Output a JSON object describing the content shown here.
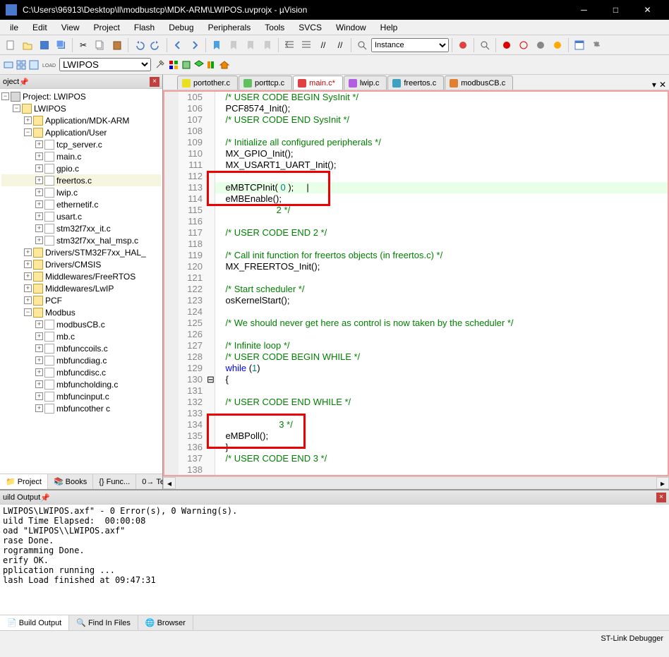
{
  "title": "C:\\Users\\96913\\Desktop\\ll\\modbustcp\\MDK-ARM\\LWIPOS.uvprojx - µVision",
  "menus": [
    "ile",
    "Edit",
    "View",
    "Project",
    "Flash",
    "Debug",
    "Peripherals",
    "Tools",
    "SVCS",
    "Window",
    "Help"
  ],
  "instance_label": "Instance",
  "target_name": "LWIPOS",
  "project": {
    "title": "oject",
    "root": "Project: LWIPOS",
    "target": "LWIPOS",
    "groups": [
      {
        "name": "Application/MDK-ARM",
        "files": []
      },
      {
        "name": "Application/User",
        "open": true,
        "files": [
          "tcp_server.c",
          "main.c",
          "gpio.c",
          "freertos.c",
          "lwip.c",
          "ethernetif.c",
          "usart.c",
          "stm32f7xx_it.c",
          "stm32f7xx_hal_msp.c"
        ]
      },
      {
        "name": "Drivers/STM32F7xx_HAL_",
        "files": []
      },
      {
        "name": "Drivers/CMSIS",
        "files": []
      },
      {
        "name": "Middlewares/FreeRTOS",
        "files": []
      },
      {
        "name": "Middlewares/LwIP",
        "files": []
      },
      {
        "name": "PCF",
        "files": []
      },
      {
        "name": "Modbus",
        "open": true,
        "files": [
          "modbusCB.c",
          "mb.c",
          "mbfunccoils.c",
          "mbfuncdiag.c",
          "mbfuncdisc.c",
          "mbfuncholding.c",
          "mbfuncinput.c",
          "mbfuncother c"
        ]
      }
    ],
    "bottom_tabs": [
      "Project",
      "Books",
      "Func...",
      "Temp..."
    ]
  },
  "editor": {
    "tabs": [
      {
        "name": "portother.c",
        "color": "#e8e020"
      },
      {
        "name": "porttcp.c",
        "color": "#60c060"
      },
      {
        "name": "main.c*",
        "color": "#e04040",
        "active": true,
        "modified": true
      },
      {
        "name": "lwip.c",
        "color": "#b060e0"
      },
      {
        "name": "freertos.c",
        "color": "#40a0c0"
      },
      {
        "name": "modbusCB.c",
        "color": "#e08030"
      }
    ],
    "first_line": 105,
    "lines": [
      {
        "t": "comment",
        "x": "    /* USER CODE BEGIN SysInit */"
      },
      {
        "t": "code",
        "x": "    PCF8574_Init();"
      },
      {
        "t": "comment",
        "x": "    /* USER CODE END SysInit */"
      },
      {
        "t": "blank",
        "x": ""
      },
      {
        "t": "comment",
        "x": "    /* Initialize all configured peripherals */"
      },
      {
        "t": "code",
        "x": "    MX_GPIO_Init();"
      },
      {
        "t": "code",
        "x": "    MX_USART1_UART_Init();"
      },
      {
        "t": "blank",
        "x": ""
      },
      {
        "t": "mbinit",
        "x": "    eMBTCPInit( 0 );",
        "hl": true
      },
      {
        "t": "mbenable",
        "x": "    eMBEnable();"
      },
      {
        "t": "comment",
        "x": "                        2 */"
      },
      {
        "t": "blank",
        "x": ""
      },
      {
        "t": "comment",
        "x": "    /* USER CODE END 2 */"
      },
      {
        "t": "blank",
        "x": ""
      },
      {
        "t": "comment",
        "x": "    /* Call init function for freertos objects (in freertos.c) */"
      },
      {
        "t": "code",
        "x": "    MX_FREERTOS_Init();"
      },
      {
        "t": "blank",
        "x": ""
      },
      {
        "t": "comment",
        "x": "    /* Start scheduler */"
      },
      {
        "t": "code",
        "x": "    osKernelStart();"
      },
      {
        "t": "blank",
        "x": ""
      },
      {
        "t": "comment",
        "x": "    /* We should never get here as control is now taken by the scheduler */"
      },
      {
        "t": "blank",
        "x": ""
      },
      {
        "t": "comment",
        "x": "    /* Infinite loop */"
      },
      {
        "t": "comment",
        "x": "    /* USER CODE BEGIN WHILE */"
      },
      {
        "t": "while",
        "x": "    while (1)"
      },
      {
        "t": "code",
        "x": "    {"
      },
      {
        "t": "blank",
        "x": ""
      },
      {
        "t": "comment",
        "x": "    /* USER CODE END WHILE */"
      },
      {
        "t": "blank",
        "x": ""
      },
      {
        "t": "comment3",
        "x": "                         3 */"
      },
      {
        "t": "mbpoll",
        "x": "    eMBPoll();"
      },
      {
        "t": "code",
        "x": "    }"
      },
      {
        "t": "comment",
        "x": "    /* USER CODE END 3 */"
      },
      {
        "t": "blank",
        "x": ""
      }
    ]
  },
  "build": {
    "title": "uild Output",
    "text": "LWIPOS\\LWIPOS.axf\" - 0 Error(s), 0 Warning(s).\nuild Time Elapsed:  00:00:08\noad \"LWIPOS\\\\LWIPOS.axf\"\nrase Done.\nrogramming Done.\nerify OK.\npplication running ...\nlash Load finished at 09:47:31",
    "tabs": [
      "Build Output",
      "Find In Files",
      "Browser"
    ]
  },
  "status": {
    "debugger": "ST-Link Debugger"
  }
}
